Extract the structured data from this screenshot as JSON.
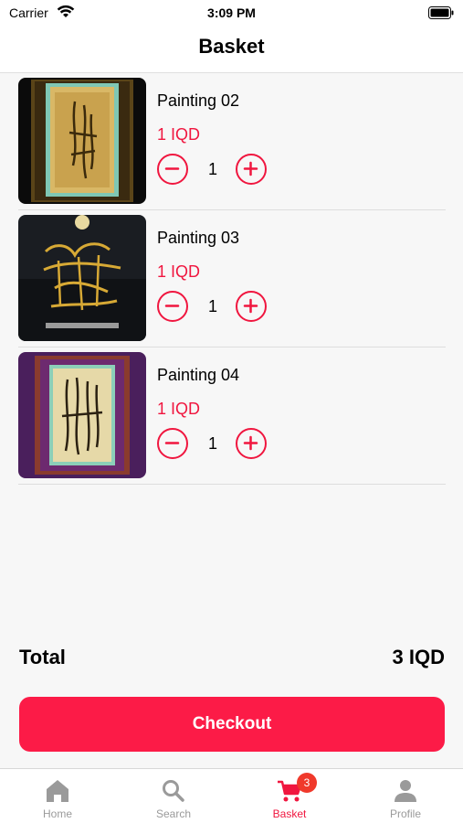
{
  "status_bar": {
    "carrier": "Carrier",
    "time": "3:09 PM"
  },
  "nav": {
    "title": "Basket"
  },
  "items": [
    {
      "name": "Painting 02",
      "price": "1 IQD",
      "quantity": "1"
    },
    {
      "name": "Painting 03",
      "price": "1 IQD",
      "quantity": "1"
    },
    {
      "name": "Painting 04",
      "price": "1 IQD",
      "quantity": "1"
    }
  ],
  "summary": {
    "total_label": "Total",
    "total_value": "3 IQD"
  },
  "checkout_label": "Checkout",
  "tabs": [
    {
      "label": "Home",
      "icon": "home-icon"
    },
    {
      "label": "Search",
      "icon": "search-icon"
    },
    {
      "label": "Basket",
      "icon": "cart-icon",
      "badge": "3",
      "active": true
    },
    {
      "label": "Profile",
      "icon": "person-icon"
    }
  ],
  "colors": {
    "accent": "#f0163f",
    "checkout": "#fc1b47",
    "badge": "#f0392b",
    "tab_inactive": "#9a9a9a"
  }
}
